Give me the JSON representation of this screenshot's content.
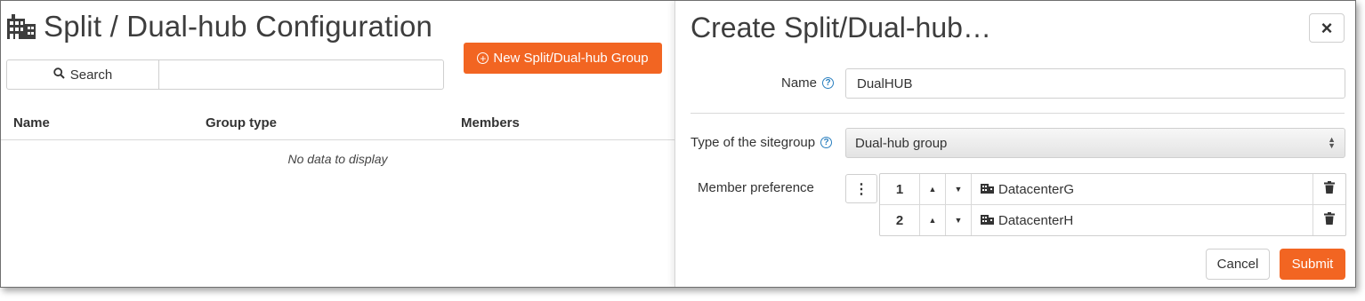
{
  "left_panel": {
    "title": "Split / Dual-hub Configuration",
    "title_icon": "building-icon",
    "search": {
      "button_label": "Search",
      "icon": "search-icon",
      "value": ""
    },
    "new_button_label": "New Split/Dual-hub Group",
    "new_button_icon": "plus-circle-icon",
    "table": {
      "columns": [
        "Name",
        "Group type",
        "Members"
      ],
      "rows": [],
      "empty_message": "No data to display"
    }
  },
  "dialog": {
    "title": "Create Split/Dual-hub…",
    "close_label": "×",
    "name_label": "Name",
    "name_value": "DualHUB",
    "type_label": "Type of the sitegroup",
    "type_value": "Dual-hub group",
    "member_label": "Member preference",
    "members": [
      {
        "order": "1",
        "name": "DatacenterG",
        "icon": "building-icon"
      },
      {
        "order": "2",
        "name": "DatacenterH",
        "icon": "building-icon"
      }
    ],
    "cancel_label": "Cancel",
    "submit_label": "Submit"
  },
  "colors": {
    "accent": "#f26522",
    "help_icon": "#2a7fbf",
    "text": "#333333"
  }
}
